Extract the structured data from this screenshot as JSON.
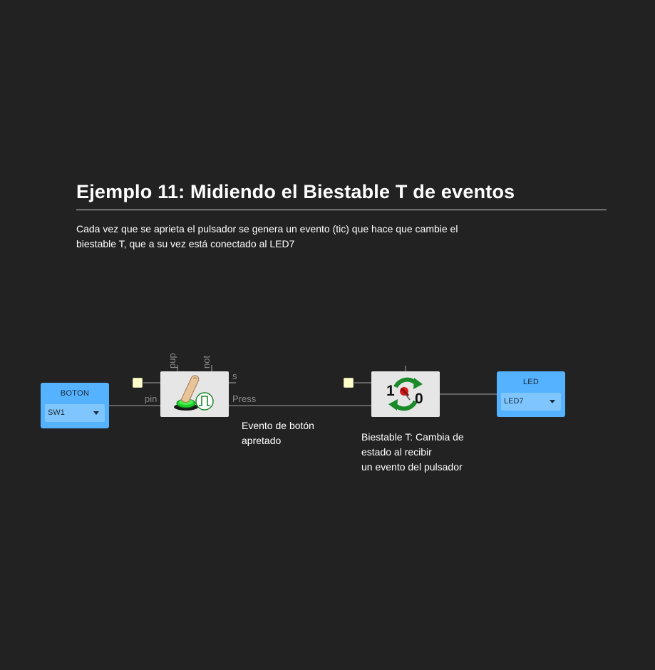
{
  "page": {
    "title": "Ejemplo 11: Midiendo el Biestable T de eventos",
    "description_lines": [
      "Cada vez que se aprieta el pulsador se genera un evento (tic) que hace que cambie el",
      "biestable T, que a su vez está conectado al LED7"
    ]
  },
  "blocks": {
    "boton": {
      "label": "BOTON",
      "value": "SW1"
    },
    "button_module": {
      "icon": "button-press-icon",
      "ports": {
        "top1": "pup",
        "top2": "not",
        "right_top": "s",
        "left": "pin",
        "right": "Press"
      }
    },
    "toggle_module": {
      "icon": "toggle-flipflop-icon",
      "digit_left": "1",
      "digit_right": "0"
    },
    "led": {
      "label": "LED",
      "value": "LED7"
    }
  },
  "notes": {
    "button_event": [
      "Evento de botón",
      "apretado"
    ],
    "biestable": [
      "Biestable T: Cambia de",
      "estado al recibir",
      "un evento del pulsador"
    ]
  },
  "colors": {
    "background": "#222222",
    "io_block": "#55b2ff",
    "module": "#e6e6e6",
    "wire": "#8a8a8a",
    "pin_square": "#ffffcc"
  }
}
